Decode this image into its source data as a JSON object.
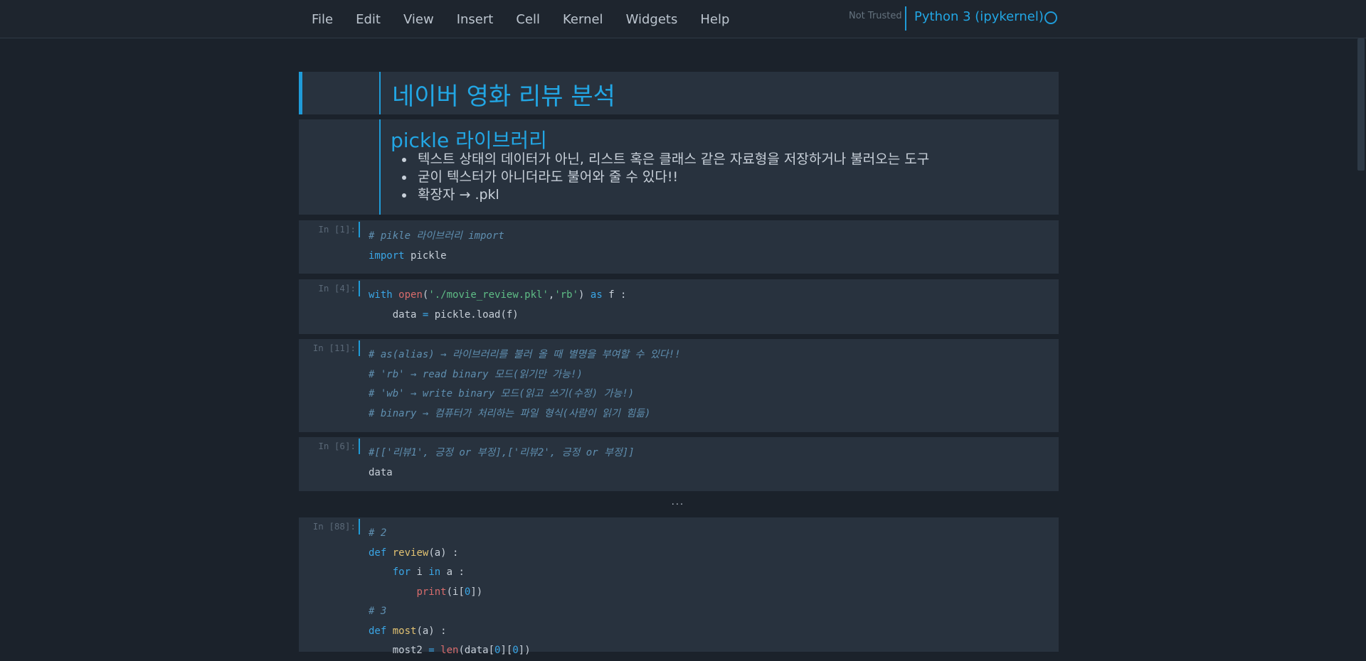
{
  "menubar": {
    "items": [
      "File",
      "Edit",
      "View",
      "Insert",
      "Cell",
      "Kernel",
      "Widgets",
      "Help"
    ],
    "not_trusted": "Not Trusted",
    "kernel_name": "Python 3 (ipykernel)"
  },
  "cells": {
    "title": {
      "heading": "네이버 영화 리뷰 분석"
    },
    "pickle_md": {
      "heading": "pickle 라이브러리",
      "bullets": [
        "텍스트 상태의 데이터가 아닌, 리스트 혹은 클래스 같은 자료형을 저장하거나 불러오는 도구",
        "굳이 텍스터가 아니더라도 불어와 줄 수 있다!!",
        "확장자 → .pkl"
      ]
    },
    "c1": {
      "prompt": "In [1]:",
      "comment": "# pikle 라이브러리 import",
      "kw_import": "import",
      "module": " pickle"
    },
    "c4": {
      "prompt": "In [4]:",
      "kw_with": "with",
      "fn_open": "open",
      "arg_path": "'./movie_review.pkl'",
      "arg_mode": "'rb'",
      "kw_as": "as",
      "target": " f :",
      "line2_var": "    data ",
      "line2_op": "=",
      "line2_rest": " pickle.load(f)"
    },
    "c11": {
      "prompt": "In [11]:",
      "lines": [
        "# as(alias) → 라이브러리를 불러 올 때 별명을 부여할 수 있다!!",
        "# 'rb' → read binary 모드(읽기만 가능!)",
        "# 'wb' → write binary 모드(읽고 쓰기(수정) 가능!)",
        "# binary → 컴퓨터가 처리하는 파일 형식(사람이 읽기 힘듦)"
      ]
    },
    "c6": {
      "prompt": "In [6]:",
      "comment": "#[['리뷰1', 긍정 or 부정],['리뷰2', 긍정 or 부정]]",
      "code": "data"
    },
    "ellipsis": "...",
    "c88": {
      "prompt": "In [88]:",
      "comment2": "# 2",
      "kw_def": "def",
      "fn_review": "review",
      "sig_review": "(a) :",
      "kw_for": "for",
      "loop_var": " i ",
      "kw_in": "in",
      "loop_iter": " a :",
      "fn_print": "print",
      "print_arg_a": "(i[",
      "print_idx": "0",
      "print_arg_b": "])",
      "comment3": "# 3",
      "fn_most": "most",
      "sig_most": "(a) :",
      "most_var": "    most2 ",
      "most_op": "=",
      "fn_len": "len",
      "len_arg_a": "(data[",
      "len_idx1": "0",
      "len_arg_b": "][",
      "len_idx2": "0",
      "len_arg_c": "])"
    }
  },
  "colors": {
    "accent": "#1f9bd8",
    "background": "#1b222b",
    "cell_bg": "#28323e",
    "heading": "#22a6e4",
    "comment": "#5f8fb0",
    "keyword": "#3aa6e6",
    "builtin": "#d96c6c",
    "string": "#5fbd86",
    "function": "#e2c272"
  },
  "icons": {
    "kernel_status": "kernel-idle-circle-icon"
  }
}
